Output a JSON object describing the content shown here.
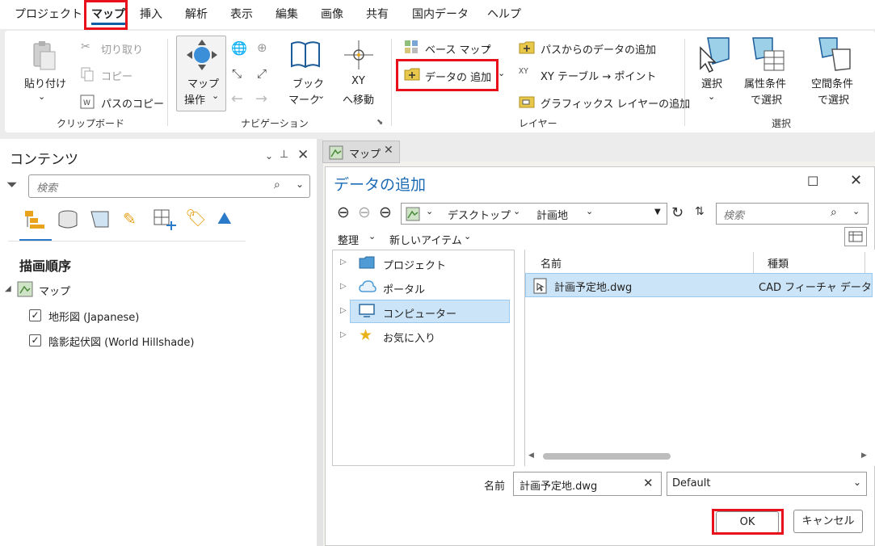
{
  "menu": {
    "items": [
      "プロジェクト",
      "マップ",
      "挿入",
      "解析",
      "表示",
      "編集",
      "画像",
      "共有",
      "国内データ",
      "ヘルプ"
    ],
    "active": "マップ"
  },
  "ribbon": {
    "clipboard": {
      "paste": "貼り付け",
      "cut": "切り取り",
      "copy": "コピー",
      "copy_path": "パスのコピー",
      "label": "クリップボード"
    },
    "navigation": {
      "explore_line1": "マップ",
      "explore_line2": "操作",
      "bookmark_line1": "ブック",
      "bookmark_line2": "マーク",
      "goto_xy_line1": "XY",
      "goto_xy_line2": "へ移動",
      "label": "ナビゲーション"
    },
    "layer": {
      "basemap": "ベース マップ",
      "add_data": "データの 追加",
      "add_data_from_path": "パスからのデータの追加",
      "xy_table": "XY テーブル → ポイント",
      "add_graphics_layer": "グラフィックス レイヤーの追加",
      "label": "レイヤー"
    },
    "selection": {
      "select": "選択",
      "select_by_attr_line1": "属性条件",
      "select_by_attr_line2": "で選択",
      "select_by_loc_line1": "空間条件",
      "select_by_loc_line2": "で選択",
      "label": "選択"
    }
  },
  "contents": {
    "title": "コンテンツ",
    "search_placeholder": "検索",
    "heading": "描画順序",
    "map_name": "マップ",
    "layers": [
      {
        "name": "地形図 (Japanese)",
        "checked": true
      },
      {
        "name": "陰影起伏図 (World Hillshade)",
        "checked": true
      }
    ]
  },
  "map_tab": {
    "label": "マップ"
  },
  "dialog": {
    "title": "データの追加",
    "path": [
      "デスクトップ",
      "計画地"
    ],
    "search_placeholder": "検索",
    "organize": "整理",
    "new_item": "新しいアイテム",
    "tree": [
      "プロジェクト",
      "ポータル",
      "コンピューター",
      "お気に入り"
    ],
    "selected_tree": "コンピューター",
    "columns": [
      "名前",
      "種類"
    ],
    "files": [
      {
        "name": "計画予定地.dwg",
        "type": "CAD フィーチャ データセ"
      }
    ],
    "name_label": "名前",
    "name_value": "計画予定地.dwg",
    "filter_value": "Default",
    "ok": "OK",
    "cancel": "キャンセル"
  },
  "colors": {
    "highlight_red": "#e8101b",
    "selection_blue": "#cce4f7",
    "accent_blue": "#0f5fa8"
  }
}
